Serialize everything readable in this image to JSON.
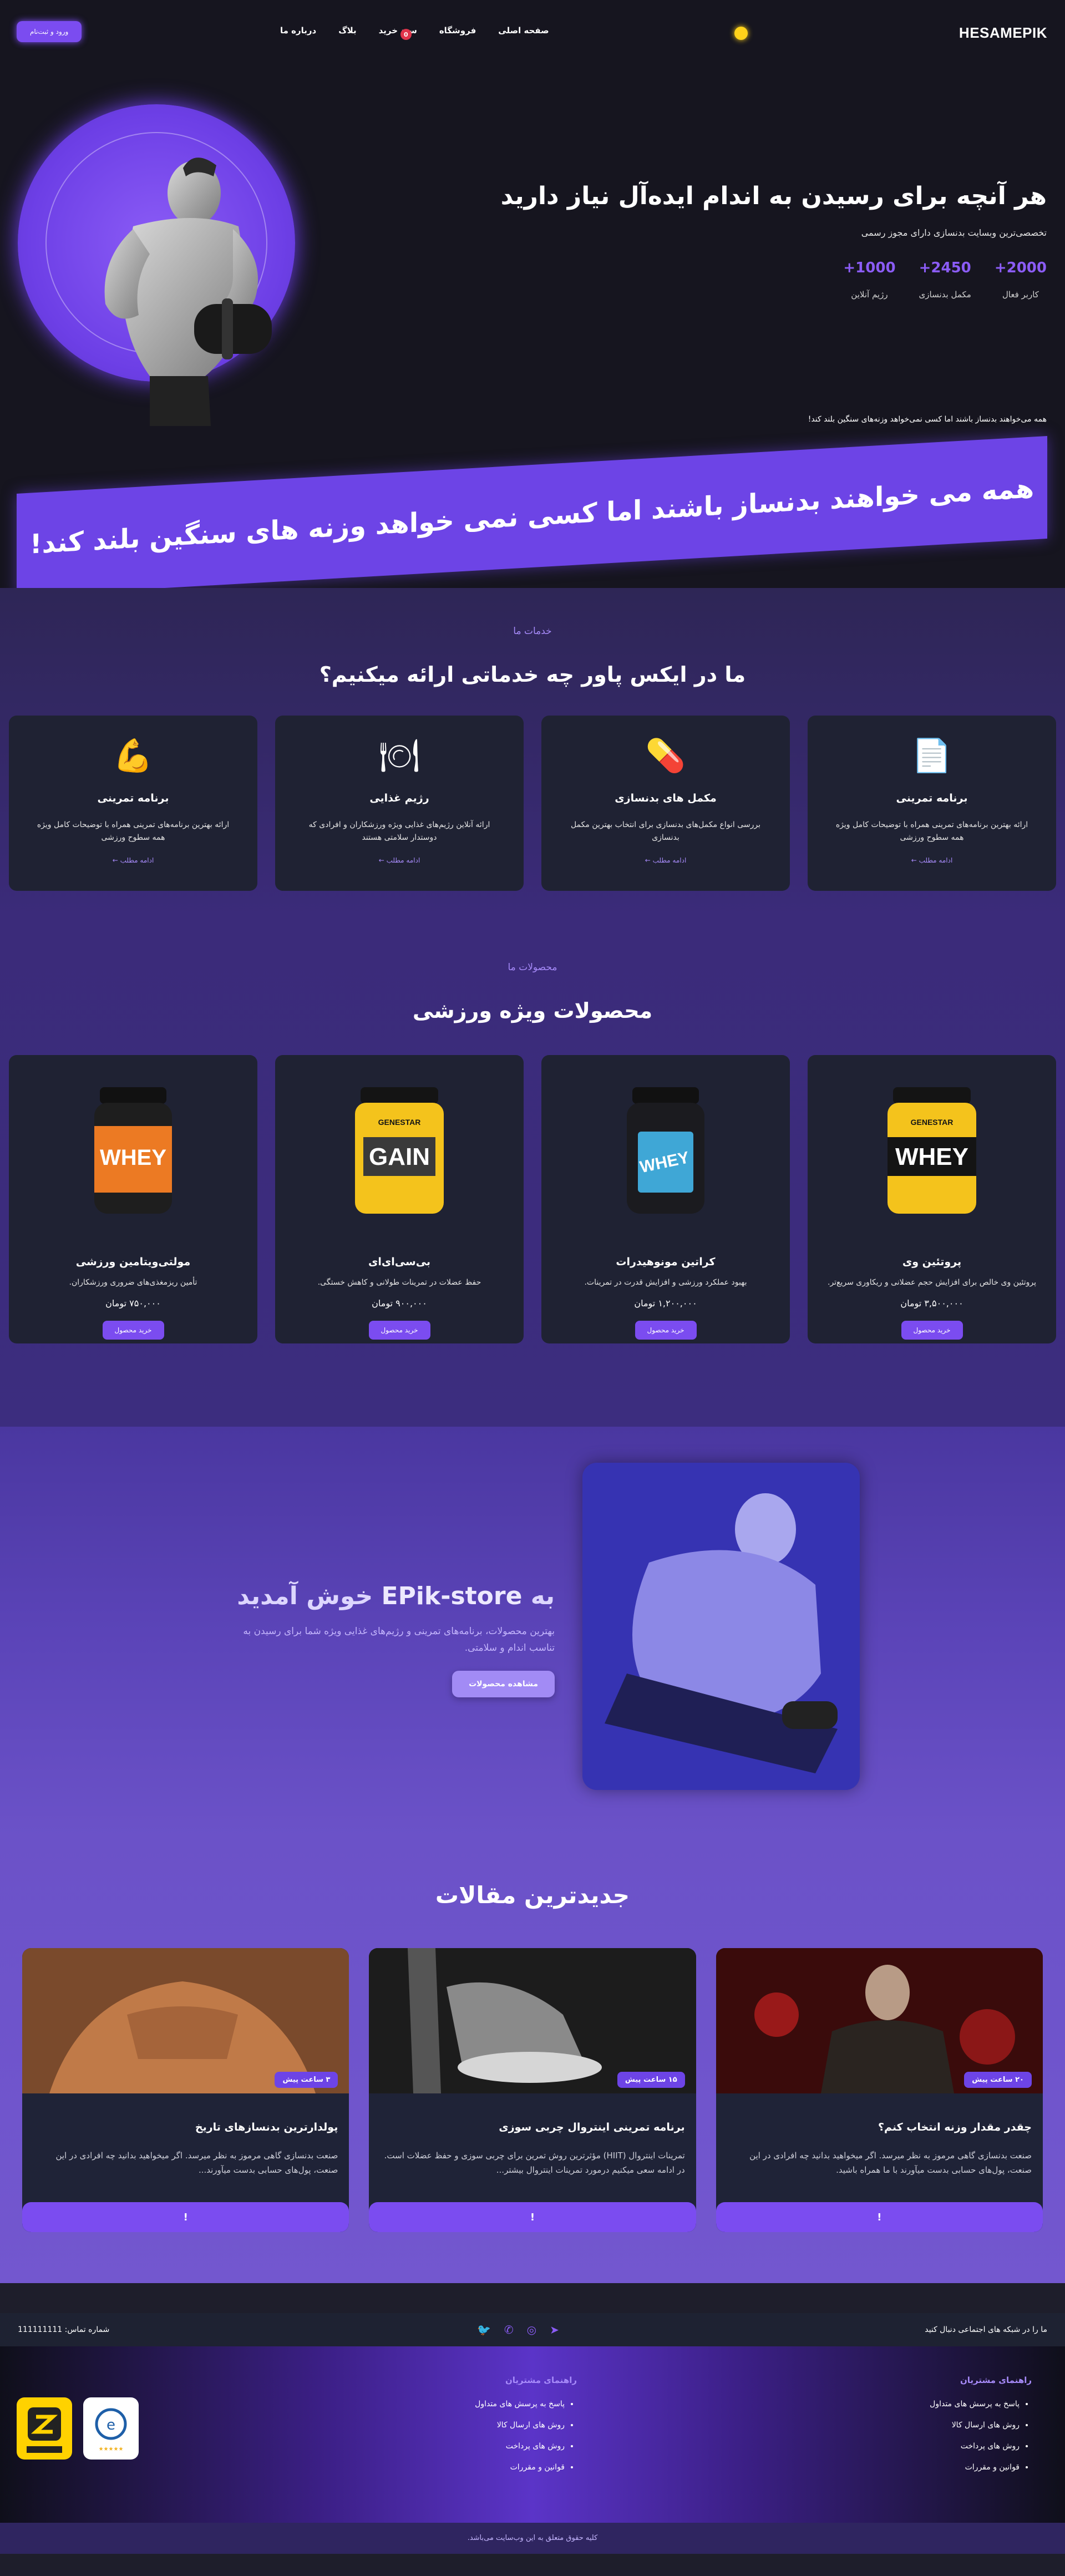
{
  "nav": {
    "brand": "HESAMEPIK",
    "menu": [
      "صفحه اصلی",
      "فروشگاه",
      "سبد خرید",
      "بلاگ",
      "درباره ما"
    ],
    "cart_count": "0",
    "login": "ورود و ثبت‌نام"
  },
  "hero": {
    "title": "هر آنچه برای رسیدن به اندام ایده‌آل نیاز دارید",
    "subtitle": "تخصصی‌ترین وبسایت بدنسازی دارای مجوز رسمی",
    "stats": [
      {
        "num": "2000+",
        "label": "کاربر فعال"
      },
      {
        "num": "2450+",
        "label": "مکمل بدنسازی"
      },
      {
        "num": "1000+",
        "label": "رژیم آنلاین"
      }
    ],
    "small_quote": "همه می‌خواهند بدنساز باشند اما کسی نمی‌خواهد وزنه‌های سنگین بلند کند!",
    "banner": "همه می خواهند بدنساز باشند اما کسی نمی خواهد وزنه های سنگین بلند کند!"
  },
  "services": {
    "kicker": "خدمات ما",
    "title": "ما در ایکس پاور چه خدماتی ارائه میکنیم؟",
    "items": [
      {
        "icon": "document-icon",
        "title": "برنامه تمرینی",
        "text": "ارائه بهترین برنامه‌های تمرینی همراه با توضیحات کامل ویژه همه سطوح ورزشی",
        "more": "ادامه مطلب ←"
      },
      {
        "icon": "capsule-icon",
        "title": "مکمل های بدنسازی",
        "text": "بررسی انواع مکمل‌های بدنسازی برای انتخاب بهترین مکمل بدنسازی",
        "more": "ادامه مطلب ←"
      },
      {
        "icon": "plate-icon",
        "title": "رژیم غذایی",
        "text": "ارائه آنلاین رژیم‌های غذایی ویژه ورزشکاران و افرادی که دوستدار سلامتی هستند",
        "more": "ادامه مطلب ←"
      },
      {
        "icon": "flexed-arm-icon",
        "title": "برنامه تمرینی",
        "text": "ارائه بهترین برنامه‌های تمرینی همراه با توضیحات کامل ویژه همه سطوح ورزشی",
        "more": "ادامه مطلب ←"
      }
    ]
  },
  "products": {
    "kicker": "محصولات ما",
    "title": "محصولات ویژه ورزشی",
    "items": [
      {
        "brand": "GENESTAR",
        "name_on_tub": "WHEY",
        "title": "پروتئین وی",
        "text": "پروتئین وی خالص برای افزایش حجم عضلانی و ریکاوری سریع‌تر.",
        "price": "۳,۵۰۰,۰۰۰ تومان",
        "btn": "خرید محصول",
        "colors": {
          "tub": "#f4c31c",
          "label": "#141414"
        }
      },
      {
        "brand": "",
        "name_on_tub": "WHEY",
        "title": "کراتین مونوهیدرات",
        "text": "بهبود عملکرد ورزشی و افزایش قدرت در تمرینات.",
        "price": "۱,۲۰۰,۰۰۰ تومان",
        "btn": "خرید محصول",
        "colors": {
          "tub": "#1b1b1f",
          "label": "#3fa7d6"
        }
      },
      {
        "brand": "GENESTAR",
        "name_on_tub": "GAIN",
        "title": "بی‌سی‌ای‌ای",
        "text": "حفظ عضلات در تمرینات طولانی و کاهش خستگی.",
        "price": "۹۰۰,۰۰۰ تومان",
        "btn": "خرید محصول",
        "colors": {
          "tub": "#f4c31c",
          "label": "#141414"
        }
      },
      {
        "brand": "",
        "name_on_tub": "WHEY",
        "title": "مولتی‌ویتامین ورزشی",
        "text": "تأمین ریزمغذی‌های ضروری ورزشکاران.",
        "price": "۷۵۰,۰۰۰ تومان",
        "btn": "خرید محصول",
        "colors": {
          "tub": "#ec7a23",
          "label": "#141414"
        }
      }
    ]
  },
  "welcome": {
    "title_prefix": "به",
    "title_brand": "EPik-store",
    "title_suffix": "خوش آمدید",
    "text": "بهترین محصولات، برنامه‌های تمرینی و رژیم‌های غذایی ویژه شما برای رسیدن به تناسب اندام و سلامتی.",
    "btn": "مشاهده محصولات"
  },
  "articles": {
    "title": "جدیدترین مقالات",
    "items": [
      {
        "time": "۲۰ ساعت پیش",
        "title": "چقدر مقدار وزنه انتخاب کنم؟",
        "text": "صنعت بدنسازی گاهی مرموز به نظر میرسد. اگر میخواهید بدانید چه افرادی در این صنعت، پول‌های حسابی بدست میآورند با ما همراه باشید.",
        "btn": "!"
      },
      {
        "time": "۱۵ ساعت پیش",
        "title": "برنامه تمرینی اینتروال چربی سوزی",
        "text": "تمرینات اینتروال (HIIT) مؤثرترین روش تمرین برای چربی سوزی و حفظ عضلات است. در ادامه سعی میکنیم درمورد تمرینات اینتروال بیشتر...",
        "btn": "!"
      },
      {
        "time": "۳ ساعت پیش",
        "title": "پولدارترین بدنسازهای تاریخ",
        "text": "صنعت بدنسازی گاهی مرموز به نظر میرسد. اگر میخواهید بدانید چه افرادی در این صنعت، پول‌های حسابی بدست میآورند...",
        "btn": "!"
      }
    ]
  },
  "footer": {
    "social_text": "ما را در شبکه های اجتماعی دنبال کنید",
    "phone_label": "شماره تماس:",
    "phone": "111111111",
    "col_title": "راهنمای مشتریان",
    "links": [
      "پاسخ به پرسش های متداول",
      "روش های ارسال کالا",
      "روش های پرداخت",
      "قوانین و مقررات"
    ],
    "copyright": "کلیه حقوق متعلق به این وب‌سایت می‌باشد.",
    "badges": [
      "enamad-badge",
      "zarinpal-badge"
    ]
  }
}
